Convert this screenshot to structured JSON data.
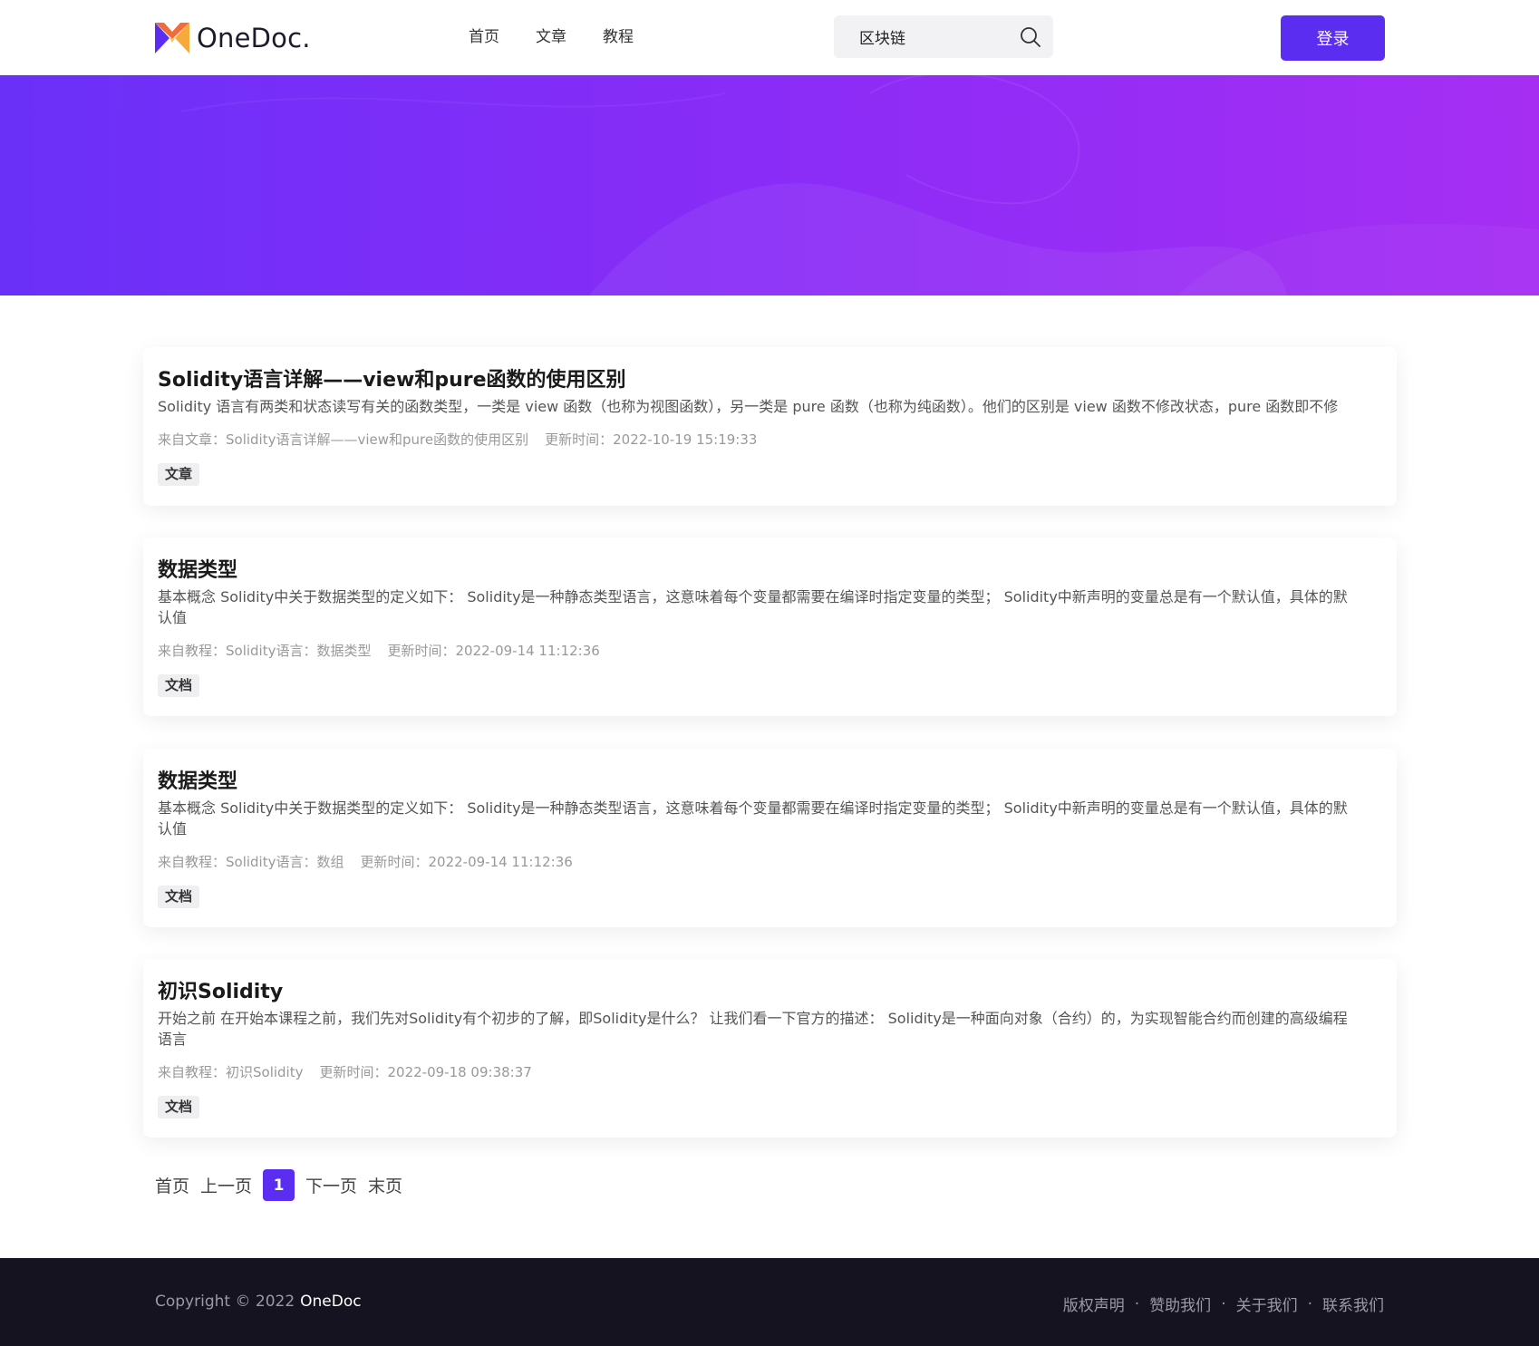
{
  "header": {
    "logo_text": "OneDoc.",
    "nav": [
      "首页",
      "文章",
      "教程"
    ],
    "search_value": "区块链",
    "login_label": "登录"
  },
  "colors": {
    "accent": "#5b2df0",
    "banner_from": "#6a30f8",
    "banner_to": "#a62ef3",
    "footer_bg": "#14131f"
  },
  "results": [
    {
      "title": "Solidity语言详解——view和pure函数的使用区别",
      "desc": "Solidity 语言有两类和状态读写有关的函数类型，一类是 view 函数（也称为视图函数），另一类是 pure 函数（也称为纯函数）。他们的区别是 view 函数不修改状态，pure 函数即不修",
      "source": "来自文章：Solidity语言详解——view和pure函数的使用区别",
      "updated": "更新时间：2022-10-19 15:19:33",
      "tag": "文章"
    },
    {
      "title": "数据类型",
      "desc": "基本概念 Solidity中关于数据类型的定义如下： Solidity是一种静态类型语言，这意味着每个变量都需要在编译时指定变量的类型； Solidity中新声明的变量总是有一个默认值，具体的默认值",
      "source": "来自教程：Solidity语言：数据类型",
      "updated": "更新时间：2022-09-14 11:12:36",
      "tag": "文档"
    },
    {
      "title": "数据类型",
      "desc": "基本概念 Solidity中关于数据类型的定义如下： Solidity是一种静态类型语言，这意味着每个变量都需要在编译时指定变量的类型； Solidity中新声明的变量总是有一个默认值，具体的默认值",
      "source": "来自教程：Solidity语言：数组",
      "updated": "更新时间：2022-09-14 11:12:36",
      "tag": "文档"
    },
    {
      "title": "初识Solidity",
      "desc": "开始之前 在开始本课程之前，我们先对Solidity有个初步的了解，即Solidity是什么？ 让我们看一下官方的描述： Solidity是一种面向对象（合约）的，为实现智能合约而创建的高级编程语言",
      "source": "来自教程：初识Solidity",
      "updated": "更新时间：2022-09-18 09:38:37",
      "tag": "文档"
    }
  ],
  "pagination": {
    "first": "首页",
    "prev": "上一页",
    "current": "1",
    "next": "下一页",
    "last": "末页"
  },
  "footer": {
    "copyright": "Copyright © 2022",
    "brand": "OneDoc",
    "links": [
      "版权声明",
      "赞助我们",
      "关于我们",
      "联系我们"
    ]
  }
}
